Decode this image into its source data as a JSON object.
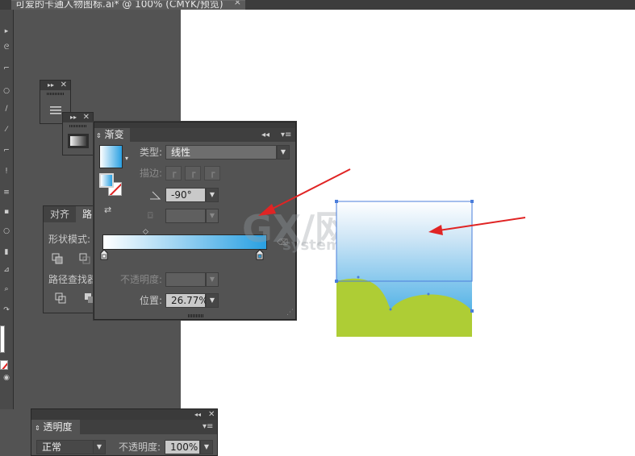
{
  "document_tab": {
    "title": "可爱的卡通人物图标.ai* @ 100% (CMYK/预览)",
    "close_glyph": "×"
  },
  "mini_panel_icons": [
    "menu-lines-icon",
    "gradient-square-icon"
  ],
  "align_pathfinder_panel": {
    "tabs": [
      "对齐",
      "路"
    ],
    "shape_modes_label": "形状模式:",
    "pathfinders_label": "路径查找器:"
  },
  "gradient_panel": {
    "tab_label": "渐变",
    "type_label": "类型:",
    "type_value": "线性",
    "stroke_label": "描边:",
    "angle_value": "-90°",
    "opacity_label": "不透明度:",
    "location_label": "位置:",
    "location_value": "26.77%",
    "gradient_start_color": "#ffffff",
    "gradient_end_color": "#29a0e2"
  },
  "transparency_panel": {
    "tab_label": "透明度",
    "blend_mode": "正常",
    "opacity_label": "不透明度:",
    "opacity_value": "100%"
  },
  "artwork": {
    "sky_top_color": "#ffffff",
    "sky_bottom_color": "#29a1e1",
    "grass_color": "#aecd35",
    "selection_color": "#4a7ddb",
    "annotation_color": "#e02424"
  },
  "watermark": {
    "text": "GX/网",
    "subtext": "system.com"
  }
}
